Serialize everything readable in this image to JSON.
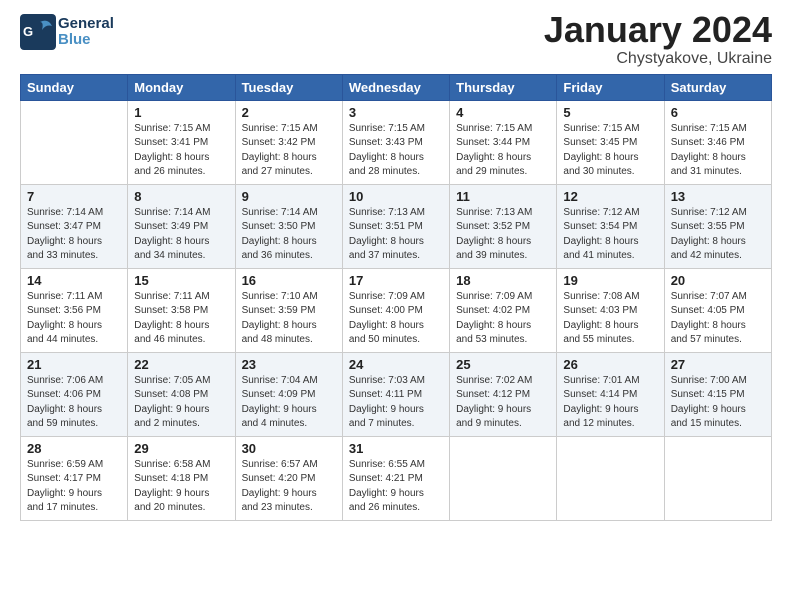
{
  "header": {
    "logo_general": "General",
    "logo_blue": "Blue",
    "month": "January 2024",
    "location": "Chystyakove, Ukraine"
  },
  "weekdays": [
    "Sunday",
    "Monday",
    "Tuesday",
    "Wednesday",
    "Thursday",
    "Friday",
    "Saturday"
  ],
  "weeks": [
    [
      {
        "day": "",
        "info": ""
      },
      {
        "day": "1",
        "info": "Sunrise: 7:15 AM\nSunset: 3:41 PM\nDaylight: 8 hours\nand 26 minutes."
      },
      {
        "day": "2",
        "info": "Sunrise: 7:15 AM\nSunset: 3:42 PM\nDaylight: 8 hours\nand 27 minutes."
      },
      {
        "day": "3",
        "info": "Sunrise: 7:15 AM\nSunset: 3:43 PM\nDaylight: 8 hours\nand 28 minutes."
      },
      {
        "day": "4",
        "info": "Sunrise: 7:15 AM\nSunset: 3:44 PM\nDaylight: 8 hours\nand 29 minutes."
      },
      {
        "day": "5",
        "info": "Sunrise: 7:15 AM\nSunset: 3:45 PM\nDaylight: 8 hours\nand 30 minutes."
      },
      {
        "day": "6",
        "info": "Sunrise: 7:15 AM\nSunset: 3:46 PM\nDaylight: 8 hours\nand 31 minutes."
      }
    ],
    [
      {
        "day": "7",
        "info": "Sunrise: 7:14 AM\nSunset: 3:47 PM\nDaylight: 8 hours\nand 33 minutes."
      },
      {
        "day": "8",
        "info": "Sunrise: 7:14 AM\nSunset: 3:49 PM\nDaylight: 8 hours\nand 34 minutes."
      },
      {
        "day": "9",
        "info": "Sunrise: 7:14 AM\nSunset: 3:50 PM\nDaylight: 8 hours\nand 36 minutes."
      },
      {
        "day": "10",
        "info": "Sunrise: 7:13 AM\nSunset: 3:51 PM\nDaylight: 8 hours\nand 37 minutes."
      },
      {
        "day": "11",
        "info": "Sunrise: 7:13 AM\nSunset: 3:52 PM\nDaylight: 8 hours\nand 39 minutes."
      },
      {
        "day": "12",
        "info": "Sunrise: 7:12 AM\nSunset: 3:54 PM\nDaylight: 8 hours\nand 41 minutes."
      },
      {
        "day": "13",
        "info": "Sunrise: 7:12 AM\nSunset: 3:55 PM\nDaylight: 8 hours\nand 42 minutes."
      }
    ],
    [
      {
        "day": "14",
        "info": "Sunrise: 7:11 AM\nSunset: 3:56 PM\nDaylight: 8 hours\nand 44 minutes."
      },
      {
        "day": "15",
        "info": "Sunrise: 7:11 AM\nSunset: 3:58 PM\nDaylight: 8 hours\nand 46 minutes."
      },
      {
        "day": "16",
        "info": "Sunrise: 7:10 AM\nSunset: 3:59 PM\nDaylight: 8 hours\nand 48 minutes."
      },
      {
        "day": "17",
        "info": "Sunrise: 7:09 AM\nSunset: 4:00 PM\nDaylight: 8 hours\nand 50 minutes."
      },
      {
        "day": "18",
        "info": "Sunrise: 7:09 AM\nSunset: 4:02 PM\nDaylight: 8 hours\nand 53 minutes."
      },
      {
        "day": "19",
        "info": "Sunrise: 7:08 AM\nSunset: 4:03 PM\nDaylight: 8 hours\nand 55 minutes."
      },
      {
        "day": "20",
        "info": "Sunrise: 7:07 AM\nSunset: 4:05 PM\nDaylight: 8 hours\nand 57 minutes."
      }
    ],
    [
      {
        "day": "21",
        "info": "Sunrise: 7:06 AM\nSunset: 4:06 PM\nDaylight: 8 hours\nand 59 minutes."
      },
      {
        "day": "22",
        "info": "Sunrise: 7:05 AM\nSunset: 4:08 PM\nDaylight: 9 hours\nand 2 minutes."
      },
      {
        "day": "23",
        "info": "Sunrise: 7:04 AM\nSunset: 4:09 PM\nDaylight: 9 hours\nand 4 minutes."
      },
      {
        "day": "24",
        "info": "Sunrise: 7:03 AM\nSunset: 4:11 PM\nDaylight: 9 hours\nand 7 minutes."
      },
      {
        "day": "25",
        "info": "Sunrise: 7:02 AM\nSunset: 4:12 PM\nDaylight: 9 hours\nand 9 minutes."
      },
      {
        "day": "26",
        "info": "Sunrise: 7:01 AM\nSunset: 4:14 PM\nDaylight: 9 hours\nand 12 minutes."
      },
      {
        "day": "27",
        "info": "Sunrise: 7:00 AM\nSunset: 4:15 PM\nDaylight: 9 hours\nand 15 minutes."
      }
    ],
    [
      {
        "day": "28",
        "info": "Sunrise: 6:59 AM\nSunset: 4:17 PM\nDaylight: 9 hours\nand 17 minutes."
      },
      {
        "day": "29",
        "info": "Sunrise: 6:58 AM\nSunset: 4:18 PM\nDaylight: 9 hours\nand 20 minutes."
      },
      {
        "day": "30",
        "info": "Sunrise: 6:57 AM\nSunset: 4:20 PM\nDaylight: 9 hours\nand 23 minutes."
      },
      {
        "day": "31",
        "info": "Sunrise: 6:55 AM\nSunset: 4:21 PM\nDaylight: 9 hours\nand 26 minutes."
      },
      {
        "day": "",
        "info": ""
      },
      {
        "day": "",
        "info": ""
      },
      {
        "day": "",
        "info": ""
      }
    ]
  ]
}
